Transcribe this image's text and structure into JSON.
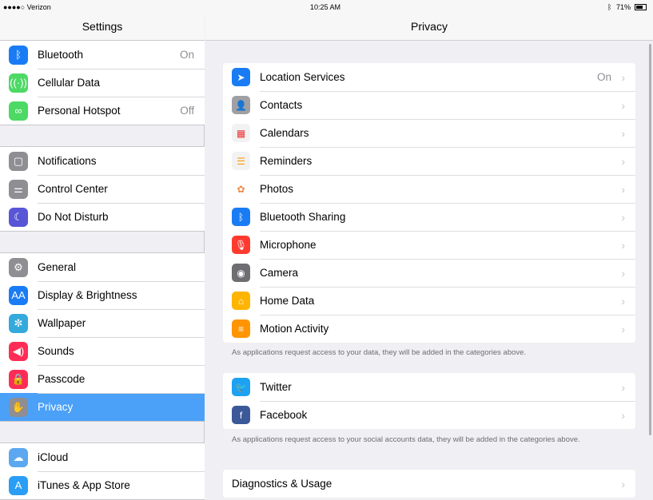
{
  "status": {
    "carrier": "●●●●○ Verizon",
    "time": "10:25 AM",
    "battery": "71%"
  },
  "sidebar": {
    "title": "Settings",
    "groups": [
      [
        {
          "label": "Bluetooth",
          "value": "On",
          "icon": "bluetooth-icon",
          "color": "#1a7cf5",
          "glyph": "ᛒ"
        },
        {
          "label": "Cellular Data",
          "icon": "cellular-icon",
          "color": "#4cd964",
          "glyph": "((·))"
        },
        {
          "label": "Personal Hotspot",
          "value": "Off",
          "icon": "hotspot-icon",
          "color": "#4cd964",
          "glyph": "∞"
        }
      ],
      [
        {
          "label": "Notifications",
          "icon": "notifications-icon",
          "color": "#8e8e93",
          "glyph": "▢"
        },
        {
          "label": "Control Center",
          "icon": "control-center-icon",
          "color": "#8e8e93",
          "glyph": "⚌"
        },
        {
          "label": "Do Not Disturb",
          "icon": "moon-icon",
          "color": "#5856d6",
          "glyph": "☾"
        }
      ],
      [
        {
          "label": "General",
          "icon": "gear-icon",
          "color": "#8e8e93",
          "glyph": "⚙"
        },
        {
          "label": "Display & Brightness",
          "icon": "display-icon",
          "color": "#1a7cf5",
          "glyph": "AA"
        },
        {
          "label": "Wallpaper",
          "icon": "wallpaper-icon",
          "color": "#34aadc",
          "glyph": "✼"
        },
        {
          "label": "Sounds",
          "icon": "speaker-icon",
          "color": "#ff2d55",
          "glyph": "◀)"
        },
        {
          "label": "Passcode",
          "icon": "lock-icon",
          "color": "#ff2d55",
          "glyph": "🔒"
        },
        {
          "label": "Privacy",
          "icon": "hand-icon",
          "color": "#8e8e93",
          "glyph": "✋",
          "selected": true
        }
      ],
      [
        {
          "label": "iCloud",
          "icon": "cloud-icon",
          "color": "#5ba8f0",
          "glyph": "☁"
        },
        {
          "label": "iTunes & App Store",
          "icon": "app-store-icon",
          "color": "#2a9ef5",
          "glyph": "A"
        }
      ]
    ]
  },
  "main": {
    "title": "Privacy",
    "group1": [
      {
        "label": "Location Services",
        "value": "On",
        "icon": "location-arrow-icon",
        "color": "#1a7cf5",
        "glyph": "➤"
      },
      {
        "label": "Contacts",
        "icon": "contacts-icon",
        "color": "#a0a0a4",
        "glyph": "👤"
      },
      {
        "label": "Calendars",
        "icon": "calendar-icon",
        "color": "#f2f2f2",
        "glyph": "▦",
        "fg": "#e33"
      },
      {
        "label": "Reminders",
        "icon": "reminders-icon",
        "color": "#f2f2f2",
        "glyph": "☰",
        "fg": "#f90"
      },
      {
        "label": "Photos",
        "icon": "photos-icon",
        "color": "#ffffff",
        "glyph": "✿",
        "fg": "#e84"
      },
      {
        "label": "Bluetooth Sharing",
        "icon": "bluetooth-icon",
        "color": "#1a7cf5",
        "glyph": "ᛒ"
      },
      {
        "label": "Microphone",
        "icon": "microphone-icon",
        "color": "#ff3b30",
        "glyph": "🎙"
      },
      {
        "label": "Camera",
        "icon": "camera-icon",
        "color": "#6d6d72",
        "glyph": "◉"
      },
      {
        "label": "Home Data",
        "icon": "home-icon",
        "color": "#ffb400",
        "glyph": "⌂"
      },
      {
        "label": "Motion Activity",
        "icon": "motion-icon",
        "color": "#ff9500",
        "glyph": "≡"
      }
    ],
    "footer1": "As applications request access to your data, they will be added in the categories above.",
    "group2": [
      {
        "label": "Twitter",
        "icon": "twitter-icon",
        "color": "#1da1f2",
        "glyph": "🐦"
      },
      {
        "label": "Facebook",
        "icon": "facebook-icon",
        "color": "#3b5998",
        "glyph": "f"
      }
    ],
    "footer2": "As applications request access to your social accounts data, they will be added in the categories above.",
    "group3": [
      {
        "label": "Diagnostics & Usage"
      }
    ]
  }
}
